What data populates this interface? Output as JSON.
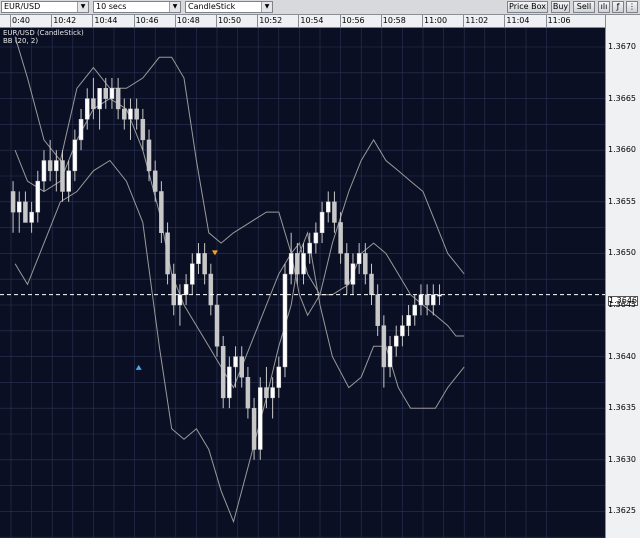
{
  "toolbar": {
    "symbol": "EUR/USD",
    "interval": "10 secs",
    "chart_style": "CandleStick",
    "price_box_label": "Price Box",
    "buy_label": "Buy",
    "sell_label": "Sell"
  },
  "time_axis": [
    "0:40",
    "10:42",
    "10:44",
    "10:46",
    "10:48",
    "10:50",
    "10:52",
    "10:54",
    "10:56",
    "10:58",
    "11:00",
    "11:02",
    "11:04",
    "11:06"
  ],
  "legend": {
    "series": "EUR/USD (CandleStick)",
    "indicator": "BB (20, 2)"
  },
  "current_price": "1.3646",
  "chart_data": {
    "type": "candlestick",
    "yticks": [
      "1.3670",
      "1.3665",
      "1.3660",
      "1.3655",
      "1.3650",
      "1.3645",
      "1.3640",
      "1.3635",
      "1.3630",
      "1.3625"
    ],
    "ylim": [
      1.3623,
      1.3674
    ],
    "current_price": 1.3646,
    "bb_upper": [
      [
        0.1,
        1.3671
      ],
      [
        0.4,
        1.3667
      ],
      [
        0.8,
        1.3661
      ],
      [
        1.2,
        1.3659
      ],
      [
        1.6,
        1.3666
      ],
      [
        2,
        1.3668
      ],
      [
        2.4,
        1.3666
      ],
      [
        2.8,
        1.3666
      ],
      [
        3.2,
        1.3667
      ],
      [
        3.6,
        1.3669
      ],
      [
        3.9,
        1.3669
      ],
      [
        4.2,
        1.3667
      ],
      [
        4.5,
        1.3659
      ],
      [
        4.8,
        1.3652
      ],
      [
        5.1,
        1.3651
      ],
      [
        5.4,
        1.3652
      ],
      [
        5.8,
        1.3653
      ],
      [
        6.2,
        1.3654
      ],
      [
        6.5,
        1.3654
      ],
      [
        6.8,
        1.365
      ],
      [
        7.0,
        1.3646
      ],
      [
        7.2,
        1.3644
      ],
      [
        7.5,
        1.3646
      ],
      [
        7.8,
        1.3651
      ],
      [
        8.2,
        1.3656
      ],
      [
        8.5,
        1.3659
      ],
      [
        8.8,
        1.3661
      ],
      [
        9.1,
        1.3659
      ],
      [
        9.4,
        1.3658
      ],
      [
        9.7,
        1.3657
      ],
      [
        10.0,
        1.3656
      ],
      [
        10.3,
        1.3653
      ],
      [
        10.6,
        1.365
      ],
      [
        10.8,
        1.3649
      ],
      [
        11.0,
        1.3648
      ]
    ],
    "bb_mid": [
      [
        0.1,
        1.366
      ],
      [
        0.4,
        1.3657
      ],
      [
        0.8,
        1.3656
      ],
      [
        1.2,
        1.3657
      ],
      [
        1.6,
        1.3661
      ],
      [
        2,
        1.3664
      ],
      [
        2.4,
        1.3665
      ],
      [
        2.8,
        1.3664
      ],
      [
        3.2,
        1.366
      ],
      [
        3.6,
        1.3654
      ],
      [
        3.9,
        1.3648
      ],
      [
        4.2,
        1.3645
      ],
      [
        4.5,
        1.3643
      ],
      [
        4.8,
        1.3641
      ],
      [
        5.1,
        1.3639
      ],
      [
        5.4,
        1.3637
      ],
      [
        5.8,
        1.3641
      ],
      [
        6.2,
        1.3645
      ],
      [
        6.5,
        1.3648
      ],
      [
        6.8,
        1.365
      ],
      [
        7.0,
        1.3651
      ],
      [
        7.2,
        1.3648
      ],
      [
        7.5,
        1.3646
      ],
      [
        7.8,
        1.3646
      ],
      [
        8.2,
        1.3647
      ],
      [
        8.5,
        1.365
      ],
      [
        8.8,
        1.3651
      ],
      [
        9.1,
        1.365
      ],
      [
        9.4,
        1.3648
      ],
      [
        9.7,
        1.3646
      ],
      [
        10.0,
        1.3645
      ],
      [
        10.3,
        1.3644
      ],
      [
        10.6,
        1.3643
      ],
      [
        10.8,
        1.3642
      ],
      [
        11.0,
        1.3642
      ]
    ],
    "bb_lower": [
      [
        0.1,
        1.3649
      ],
      [
        0.4,
        1.3647
      ],
      [
        0.8,
        1.3651
      ],
      [
        1.2,
        1.3655
      ],
      [
        1.6,
        1.3656
      ],
      [
        2,
        1.3658
      ],
      [
        2.4,
        1.3659
      ],
      [
        2.8,
        1.3657
      ],
      [
        3.2,
        1.3653
      ],
      [
        3.6,
        1.3641
      ],
      [
        3.9,
        1.3633
      ],
      [
        4.2,
        1.3632
      ],
      [
        4.5,
        1.3633
      ],
      [
        4.8,
        1.3631
      ],
      [
        5.1,
        1.3627
      ],
      [
        5.4,
        1.3624
      ],
      [
        5.8,
        1.363
      ],
      [
        6.2,
        1.3636
      ],
      [
        6.5,
        1.3641
      ],
      [
        6.8,
        1.3645
      ],
      [
        7.0,
        1.365
      ],
      [
        7.2,
        1.3652
      ],
      [
        7.5,
        1.3645
      ],
      [
        7.8,
        1.364
      ],
      [
        8.2,
        1.3637
      ],
      [
        8.5,
        1.3638
      ],
      [
        8.8,
        1.3641
      ],
      [
        9.1,
        1.3641
      ],
      [
        9.4,
        1.3637
      ],
      [
        9.7,
        1.3635
      ],
      [
        10.0,
        1.3635
      ],
      [
        10.3,
        1.3635
      ],
      [
        10.6,
        1.3637
      ],
      [
        10.8,
        1.3638
      ],
      [
        11.0,
        1.3639
      ]
    ],
    "candles": [
      [
        0.05,
        1.3656,
        1.3657,
        1.3652,
        1.3654
      ],
      [
        0.2,
        1.3654,
        1.3656,
        1.3652,
        1.3655
      ],
      [
        0.35,
        1.3655,
        1.3656,
        1.3653,
        1.3653
      ],
      [
        0.5,
        1.3653,
        1.3655,
        1.3652,
        1.3654
      ],
      [
        0.65,
        1.3654,
        1.3658,
        1.3653,
        1.3657
      ],
      [
        0.8,
        1.3657,
        1.366,
        1.3656,
        1.3659
      ],
      [
        0.95,
        1.3659,
        1.3661,
        1.3657,
        1.3658
      ],
      [
        1.1,
        1.3658,
        1.366,
        1.3656,
        1.3659
      ],
      [
        1.25,
        1.3659,
        1.366,
        1.3655,
        1.3656
      ],
      [
        1.4,
        1.3656,
        1.3659,
        1.3655,
        1.3658
      ],
      [
        1.55,
        1.3658,
        1.3662,
        1.3657,
        1.3661
      ],
      [
        1.7,
        1.3661,
        1.3664,
        1.366,
        1.3663
      ],
      [
        1.85,
        1.3663,
        1.3666,
        1.3662,
        1.3665
      ],
      [
        2.0,
        1.3665,
        1.3667,
        1.3663,
        1.3664
      ],
      [
        2.15,
        1.3664,
        1.3666,
        1.3662,
        1.3666
      ],
      [
        2.3,
        1.3666,
        1.3667,
        1.3664,
        1.3665
      ],
      [
        2.45,
        1.3665,
        1.3667,
        1.3664,
        1.3666
      ],
      [
        2.6,
        1.3666,
        1.3667,
        1.3663,
        1.3664
      ],
      [
        2.75,
        1.3664,
        1.3665,
        1.3662,
        1.3663
      ],
      [
        2.9,
        1.3663,
        1.3665,
        1.3661,
        1.3664
      ],
      [
        3.05,
        1.3664,
        1.3665,
        1.3662,
        1.3663
      ],
      [
        3.2,
        1.3663,
        1.3664,
        1.366,
        1.3661
      ],
      [
        3.35,
        1.3661,
        1.3662,
        1.3657,
        1.3658
      ],
      [
        3.5,
        1.3658,
        1.3659,
        1.3655,
        1.3656
      ],
      [
        3.65,
        1.3656,
        1.3657,
        1.3651,
        1.3652
      ],
      [
        3.8,
        1.3652,
        1.3653,
        1.3647,
        1.3648
      ],
      [
        3.95,
        1.3648,
        1.3649,
        1.3644,
        1.3645
      ],
      [
        4.1,
        1.3645,
        1.3647,
        1.3643,
        1.3646
      ],
      [
        4.25,
        1.3646,
        1.3648,
        1.3645,
        1.3647
      ],
      [
        4.4,
        1.3647,
        1.365,
        1.3646,
        1.3649
      ],
      [
        4.55,
        1.3649,
        1.3651,
        1.3648,
        1.365
      ],
      [
        4.7,
        1.365,
        1.3651,
        1.3647,
        1.3648
      ],
      [
        4.85,
        1.3648,
        1.3649,
        1.3644,
        1.3645
      ],
      [
        5.0,
        1.3645,
        1.3646,
        1.364,
        1.3641
      ],
      [
        5.15,
        1.3641,
        1.3642,
        1.3635,
        1.3636
      ],
      [
        5.3,
        1.3636,
        1.364,
        1.3635,
        1.3639
      ],
      [
        5.45,
        1.3639,
        1.3641,
        1.3637,
        1.364
      ],
      [
        5.6,
        1.364,
        1.3641,
        1.3637,
        1.3638
      ],
      [
        5.75,
        1.3638,
        1.3639,
        1.3634,
        1.3635
      ],
      [
        5.9,
        1.3635,
        1.3636,
        1.363,
        1.3631
      ],
      [
        6.05,
        1.3631,
        1.3638,
        1.363,
        1.3637
      ],
      [
        6.2,
        1.3637,
        1.3639,
        1.3635,
        1.3636
      ],
      [
        6.35,
        1.3636,
        1.3638,
        1.3634,
        1.3637
      ],
      [
        6.5,
        1.3637,
        1.364,
        1.3636,
        1.3639
      ],
      [
        6.65,
        1.3639,
        1.3649,
        1.3638,
        1.3648
      ],
      [
        6.8,
        1.3648,
        1.3652,
        1.3647,
        1.365
      ],
      [
        6.95,
        1.365,
        1.3651,
        1.3647,
        1.3648
      ],
      [
        7.1,
        1.3648,
        1.3651,
        1.3647,
        1.365
      ],
      [
        7.25,
        1.365,
        1.3652,
        1.3649,
        1.3651
      ],
      [
        7.4,
        1.3651,
        1.3653,
        1.365,
        1.3652
      ],
      [
        7.55,
        1.3652,
        1.3655,
        1.3651,
        1.3654
      ],
      [
        7.7,
        1.3654,
        1.3656,
        1.3653,
        1.3655
      ],
      [
        7.85,
        1.3655,
        1.3656,
        1.3652,
        1.3653
      ],
      [
        8.0,
        1.3653,
        1.3654,
        1.3649,
        1.365
      ],
      [
        8.15,
        1.365,
        1.3651,
        1.3646,
        1.3647
      ],
      [
        8.3,
        1.3647,
        1.365,
        1.3646,
        1.3649
      ],
      [
        8.45,
        1.3649,
        1.3651,
        1.3648,
        1.365
      ],
      [
        8.6,
        1.365,
        1.3651,
        1.3647,
        1.3648
      ],
      [
        8.75,
        1.3648,
        1.3649,
        1.3645,
        1.3646
      ],
      [
        8.9,
        1.3646,
        1.3647,
        1.3642,
        1.3643
      ],
      [
        9.05,
        1.3643,
        1.3644,
        1.3637,
        1.3639
      ],
      [
        9.2,
        1.3639,
        1.3642,
        1.3638,
        1.3641
      ],
      [
        9.35,
        1.3641,
        1.3643,
        1.364,
        1.3642
      ],
      [
        9.5,
        1.3642,
        1.3644,
        1.3641,
        1.3643
      ],
      [
        9.65,
        1.3643,
        1.3645,
        1.3642,
        1.3644
      ],
      [
        9.8,
        1.3644,
        1.3646,
        1.3643,
        1.3645
      ],
      [
        9.95,
        1.3645,
        1.3647,
        1.3644,
        1.3646
      ],
      [
        10.1,
        1.3646,
        1.3647,
        1.3644,
        1.3645
      ],
      [
        10.25,
        1.3645,
        1.3647,
        1.3644,
        1.3646
      ],
      [
        10.4,
        1.3646,
        1.3647,
        1.3645,
        1.3646
      ]
    ],
    "markers": [
      {
        "x": 4.95,
        "price": 1.365,
        "kind": "sell"
      },
      {
        "x": 3.1,
        "price": 1.3639,
        "kind": "buy"
      }
    ]
  },
  "colors": {
    "background": "#0a0f24",
    "grid": "#2a3455",
    "candle": "#c8c8c8",
    "bands": "#9a9a9a",
    "sell_marker": "#f0a030",
    "buy_marker": "#4aa8e8"
  }
}
